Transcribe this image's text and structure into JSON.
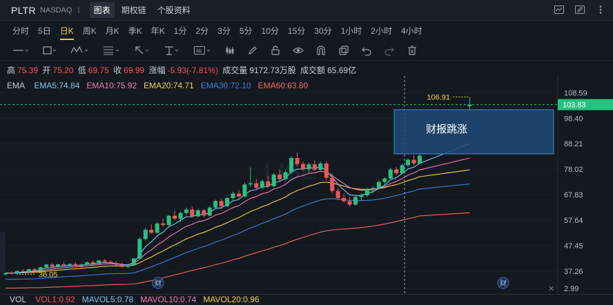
{
  "header": {
    "ticker": "PLTR",
    "exchange": "NASDAQ",
    "separator": "I",
    "tabs": [
      {
        "label": "图表",
        "active": true
      },
      {
        "label": "期权链",
        "active": false
      },
      {
        "label": "个股资料",
        "active": false
      }
    ]
  },
  "periods": [
    {
      "label": "分时",
      "active": false
    },
    {
      "label": "5日",
      "active": false
    },
    {
      "label": "日K",
      "active": true
    },
    {
      "label": "周K",
      "active": false
    },
    {
      "label": "月K",
      "active": false
    },
    {
      "label": "季K",
      "active": false
    },
    {
      "label": "年K",
      "active": false
    },
    {
      "label": "1分",
      "active": false
    },
    {
      "label": "2分",
      "active": false
    },
    {
      "label": "3分",
      "active": false
    },
    {
      "label": "5分",
      "active": false
    },
    {
      "label": "10分",
      "active": false
    },
    {
      "label": "15分",
      "active": false
    },
    {
      "label": "30分",
      "active": false
    },
    {
      "label": "1小时",
      "active": false
    },
    {
      "label": "2小时",
      "active": false
    },
    {
      "label": "4小时",
      "active": false
    }
  ],
  "tools": [
    "line-tool-icon",
    "rectangle-tool-icon",
    "wave-tool-icon",
    "fibonacci-tool-icon",
    "arrow-tool-icon",
    "measure-tool-icon",
    "text-tool-icon",
    "candle-tool-icon",
    "pen-tool-icon",
    "lock-icon",
    "eye-icon",
    "magnet-icon",
    "copy-icon",
    "undo-icon",
    "redo-icon",
    "trash-icon"
  ],
  "ohlc": {
    "high_label": "高",
    "high": "75.39",
    "open_label": "开",
    "open": "75.20",
    "low_label": "低",
    "low": "69.75",
    "close_label": "收",
    "close": "69.99",
    "change_label": "涨幅",
    "change": "-5.93(-7.81%)",
    "volume_label": "成交量",
    "volume": "9172.73万股",
    "turnover_label": "成交额",
    "turnover": "65.69亿"
  },
  "ema": {
    "label": "EMA",
    "items": [
      {
        "text": "EMA5:74.84",
        "color": "#7ec8f2"
      },
      {
        "text": "EMA10:75.92",
        "color": "#f27bb8"
      },
      {
        "text": "EMA20:74.71",
        "color": "#f2d14c"
      },
      {
        "text": "EMA30:72.10",
        "color": "#3d7fe0"
      },
      {
        "text": "EMA60:63.80",
        "color": "#f26b5b"
      }
    ]
  },
  "price_axis": {
    "ticks": [
      "108.59",
      "98.40",
      "88.21",
      "78.02",
      "67.83",
      "57.64",
      "47.45",
      "37.26"
    ],
    "current": "103.83",
    "last_tick": "2.99"
  },
  "annotations": {
    "peak_label": "106.91",
    "low_label": "36.05",
    "box_text": "财报跳涨",
    "earnings_marker": "财"
  },
  "volume": {
    "label": "VOL",
    "items": [
      {
        "text": "VOL1:0.92",
        "color": "#f2545b"
      },
      {
        "text": "MAVOL5:0.78",
        "color": "#7ec8f2"
      },
      {
        "text": "MAVOL10:0.74",
        "color": "#f27bb8"
      },
      {
        "text": "MAVOL20:0.96",
        "color": "#f2d14c"
      }
    ]
  },
  "colors": {
    "up": "#26c281",
    "down": "#f2545b",
    "background": "#14181f",
    "accent": "#f2c94c",
    "current_price_bg": "#26c281",
    "box_fill": "#1e4a78",
    "box_border": "#3a8fd8"
  },
  "chart_data": {
    "type": "candlestick",
    "ylim": [
      32.0,
      112.0
    ],
    "candles": [
      [
        36.0,
        36.9,
        35.4,
        36.5
      ],
      [
        36.5,
        37.2,
        36.0,
        36.2
      ],
      [
        36.2,
        37.6,
        35.8,
        37.3
      ],
      [
        37.3,
        38.1,
        36.9,
        37.0
      ],
      [
        37.0,
        38.2,
        36.5,
        38.0
      ],
      [
        38.0,
        38.6,
        37.1,
        37.4
      ],
      [
        37.4,
        39.0,
        37.0,
        38.8
      ],
      [
        38.8,
        40.2,
        38.4,
        39.9
      ],
      [
        39.9,
        40.5,
        38.7,
        39.1
      ],
      [
        39.1,
        40.3,
        38.6,
        40.0
      ],
      [
        40.0,
        41.0,
        39.2,
        39.5
      ],
      [
        39.5,
        40.4,
        38.9,
        40.1
      ],
      [
        40.1,
        40.8,
        39.0,
        39.3
      ],
      [
        39.3,
        40.2,
        38.5,
        39.9
      ],
      [
        39.9,
        41.2,
        39.5,
        40.8
      ],
      [
        40.8,
        41.5,
        39.9,
        40.2
      ],
      [
        40.2,
        41.8,
        40.0,
        41.5
      ],
      [
        41.5,
        42.1,
        40.6,
        41.0
      ],
      [
        41.0,
        41.6,
        40.1,
        40.5
      ],
      [
        40.5,
        41.2,
        39.4,
        39.8
      ],
      [
        39.8,
        40.6,
        38.6,
        39.0
      ],
      [
        39.0,
        40.1,
        38.4,
        39.6
      ],
      [
        39.6,
        42.6,
        39.3,
        42.3
      ],
      [
        42.3,
        50.8,
        42.0,
        50.1
      ],
      [
        50.1,
        54.6,
        49.6,
        53.8
      ],
      [
        53.8,
        56.0,
        52.1,
        52.6
      ],
      [
        52.6,
        56.9,
        52.2,
        56.3
      ],
      [
        56.3,
        58.2,
        55.1,
        55.7
      ],
      [
        55.7,
        59.8,
        55.3,
        59.4
      ],
      [
        59.4,
        61.6,
        57.6,
        58.2
      ],
      [
        58.2,
        61.1,
        56.8,
        60.5
      ],
      [
        60.5,
        62.6,
        59.6,
        61.9
      ],
      [
        61.9,
        63.1,
        58.6,
        59.2
      ],
      [
        59.2,
        62.2,
        58.6,
        61.6
      ],
      [
        61.6,
        62.1,
        58.9,
        59.5
      ],
      [
        59.5,
        63.2,
        59.1,
        62.7
      ],
      [
        62.7,
        65.9,
        62.1,
        65.3
      ],
      [
        65.3,
        66.1,
        62.6,
        63.2
      ],
      [
        63.2,
        67.1,
        62.9,
        66.5
      ],
      [
        66.5,
        69.1,
        65.2,
        68.3
      ],
      [
        68.3,
        69.7,
        66.6,
        67.1
      ],
      [
        67.1,
        72.6,
        66.8,
        71.9
      ],
      [
        71.9,
        78.7,
        70.9,
        72.4
      ],
      [
        72.4,
        74.1,
        69.6,
        70.6
      ],
      [
        70.6,
        73.9,
        69.9,
        73.2
      ],
      [
        73.2,
        75.3,
        70.6,
        71.2
      ],
      [
        71.2,
        76.6,
        70.8,
        75.9
      ],
      [
        75.9,
        77.9,
        73.1,
        74.0
      ],
      [
        74.0,
        77.6,
        73.6,
        76.8
      ],
      [
        76.8,
        83.2,
        76.1,
        82.5
      ],
      [
        82.5,
        84.7,
        79.3,
        80.1
      ],
      [
        80.1,
        81.1,
        77.4,
        78.0
      ],
      [
        78.0,
        80.6,
        76.6,
        79.9
      ],
      [
        79.9,
        81.6,
        77.2,
        77.8
      ],
      [
        77.8,
        81.0,
        76.9,
        80.3
      ],
      [
        80.3,
        81.3,
        73.6,
        74.6
      ],
      [
        74.6,
        76.4,
        68.4,
        69.3
      ],
      [
        69.3,
        70.6,
        65.6,
        66.5
      ],
      [
        66.5,
        68.1,
        64.6,
        65.2
      ],
      [
        65.2,
        67.1,
        63.2,
        63.8
      ],
      [
        63.8,
        67.6,
        63.4,
        66.9
      ],
      [
        66.9,
        68.4,
        65.4,
        67.6
      ],
      [
        67.6,
        70.6,
        66.9,
        69.9
      ],
      [
        69.9,
        71.1,
        68.3,
        70.5
      ],
      [
        70.5,
        73.6,
        70.1,
        72.9
      ],
      [
        72.9,
        74.9,
        71.4,
        74.3
      ],
      [
        74.3,
        78.6,
        73.9,
        77.9
      ],
      [
        77.9,
        78.9,
        75.6,
        76.4
      ],
      [
        76.4,
        80.1,
        75.9,
        79.6
      ],
      [
        79.6,
        82.3,
        79.0,
        81.8
      ],
      [
        81.8,
        83.6,
        79.6,
        80.3
      ],
      [
        80.3,
        84.1,
        79.9,
        83.4
      ],
      [
        103.2,
        106.9,
        101.6,
        103.83
      ]
    ]
  }
}
